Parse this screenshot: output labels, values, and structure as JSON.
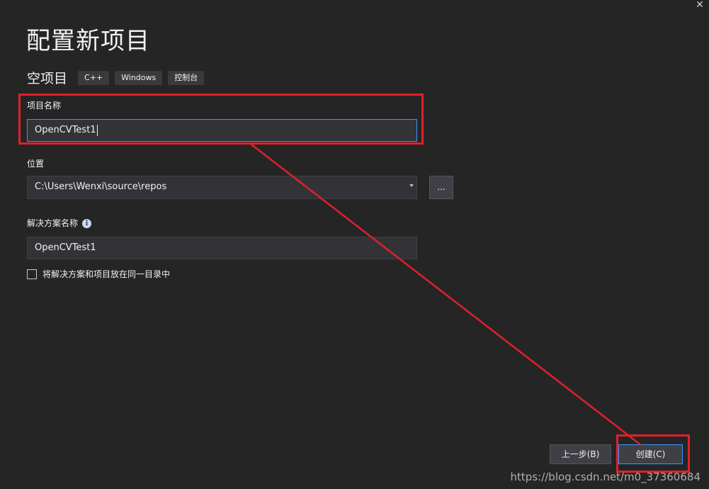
{
  "window": {
    "close_glyph": "✕"
  },
  "header": {
    "title": "配置新项目"
  },
  "template": {
    "name": "空项目",
    "tags": [
      "C++",
      "Windows",
      "控制台"
    ]
  },
  "fields": {
    "project_name": {
      "label": "项目名称",
      "value": "OpenCVTest1"
    },
    "location": {
      "label": "位置",
      "value": "C:\\Users\\Wenxi\\source\\repos",
      "browse_label": "..."
    },
    "solution_name": {
      "label": "解决方案名称",
      "value": "OpenCVTest1",
      "info_glyph": "i"
    },
    "same_dir": {
      "label": "将解决方案和项目放在同一目录中",
      "checked": false
    }
  },
  "footer": {
    "back_label": "上一步(B)",
    "create_label": "创建(C)"
  },
  "watermark": "https://blog.csdn.net/m0_37360684",
  "colors": {
    "annotation_red": "#e0202a",
    "focus_blue": "#3399ff",
    "background": "#252526"
  }
}
